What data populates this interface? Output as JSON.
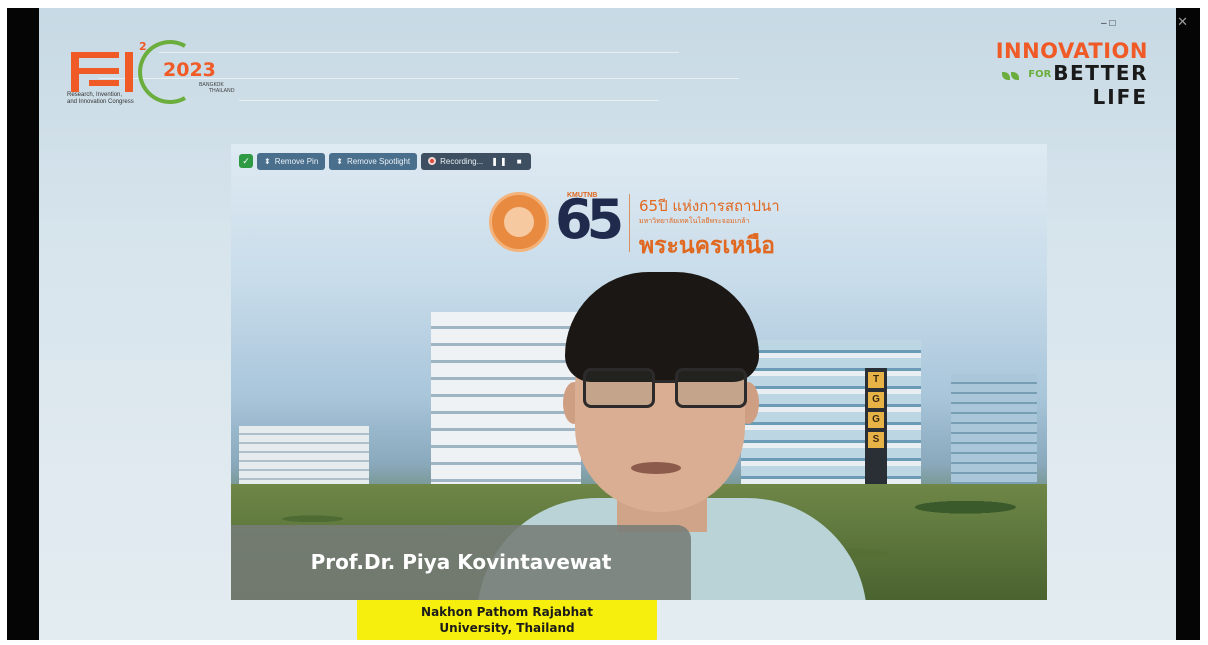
{
  "window": {
    "close_glyph": "✕",
    "ghost_controls": "–    □"
  },
  "event_logo": {
    "mark": "RI",
    "superscript": "2",
    "year": "2023",
    "location_line1": "BANGKOK",
    "location_line2": "THAILAND",
    "subtitle_line1": "Research, Invention,",
    "subtitle_line2": "and Innovation Congress",
    "colors": {
      "orange": "#ef5a26",
      "green": "#6bae3d"
    }
  },
  "theme_logo": {
    "line1": "INNOVATION",
    "for": "FOR",
    "line2": "BETTER",
    "line3": "LIFE"
  },
  "meeting_toolbar": {
    "shield_icon": "shield-check-icon",
    "remove_pin": "Remove Pin",
    "remove_spotlight": "Remove Spotlight",
    "recording": "Recording...",
    "pause_icon": "❚❚",
    "stop_icon": "■"
  },
  "banner": {
    "brand": "KMUTNB",
    "number": "65",
    "line1": "65ปี แห่งการสถาปนา",
    "line2": "มหาวิทยาลัยเทคโนโลยีพระจอมเกล้า",
    "line3": "พระนครเหนือ"
  },
  "tower_letters": [
    "T",
    "G",
    "G",
    "S"
  ],
  "speaker": {
    "name": "Prof.Dr. Piya Kovintavewat",
    "affiliation_line1": "Nakhon Pathom Rajabhat",
    "affiliation_line2": "University, Thailand"
  }
}
